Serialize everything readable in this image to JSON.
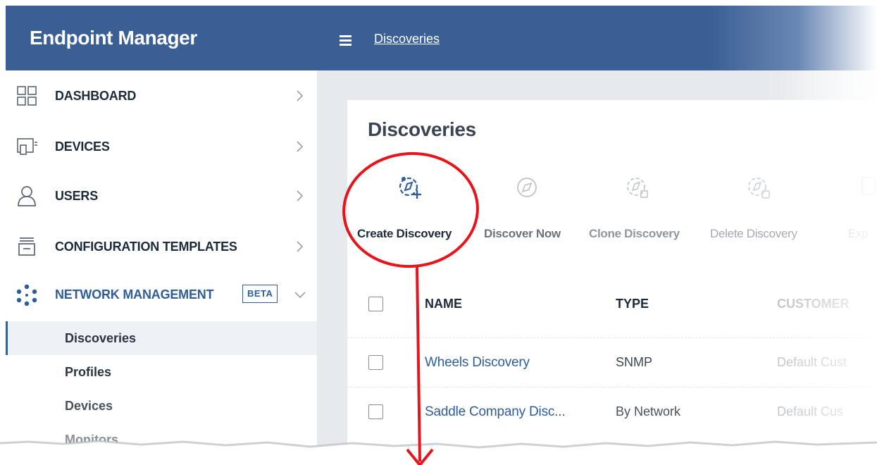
{
  "sidebar": {
    "brand": "Endpoint Manager",
    "items": [
      {
        "label": "DASHBOARD",
        "icon": "dashboard-grid-icon"
      },
      {
        "label": "DEVICES",
        "icon": "devices-icon"
      },
      {
        "label": "USERS",
        "icon": "user-icon"
      },
      {
        "label": "CONFIGURATION TEMPLATES",
        "icon": "configuration-templates-icon"
      },
      {
        "label": "NETWORK MANAGEMENT",
        "icon": "network-management-icon",
        "badge": "BETA",
        "expanded": true
      }
    ],
    "subitems": [
      {
        "label": "Discoveries",
        "active": true
      },
      {
        "label": "Profiles"
      },
      {
        "label": "Devices"
      },
      {
        "label": "Monitors"
      }
    ]
  },
  "header": {
    "menu_icon": "hamburger-icon",
    "breadcrumb": "Discoveries"
  },
  "main": {
    "title": "Discoveries",
    "toolbar": [
      {
        "label": "Create Discovery",
        "icon": "create-discovery-icon",
        "enabled": true
      },
      {
        "label": "Discover Now",
        "icon": "discover-now-icon",
        "enabled": false
      },
      {
        "label": "Clone Discovery",
        "icon": "clone-discovery-icon",
        "enabled": false
      },
      {
        "label": "Delete Discovery",
        "icon": "delete-discovery-icon",
        "enabled": false
      },
      {
        "label": "Exp",
        "icon": "export-icon",
        "enabled": false
      }
    ],
    "table": {
      "columns": [
        "NAME",
        "TYPE",
        "CUSTOMER"
      ],
      "rows": [
        {
          "name": "Wheels Discovery",
          "type": "SNMP",
          "customer": "Default Cust"
        },
        {
          "name": "Saddle Company Disc...",
          "type": "By Network",
          "customer": "Default Cus"
        }
      ]
    }
  },
  "colors": {
    "header_blue": "#3a5f94",
    "link_blue": "#2f5d9a",
    "annotation_red": "#e8141b"
  }
}
